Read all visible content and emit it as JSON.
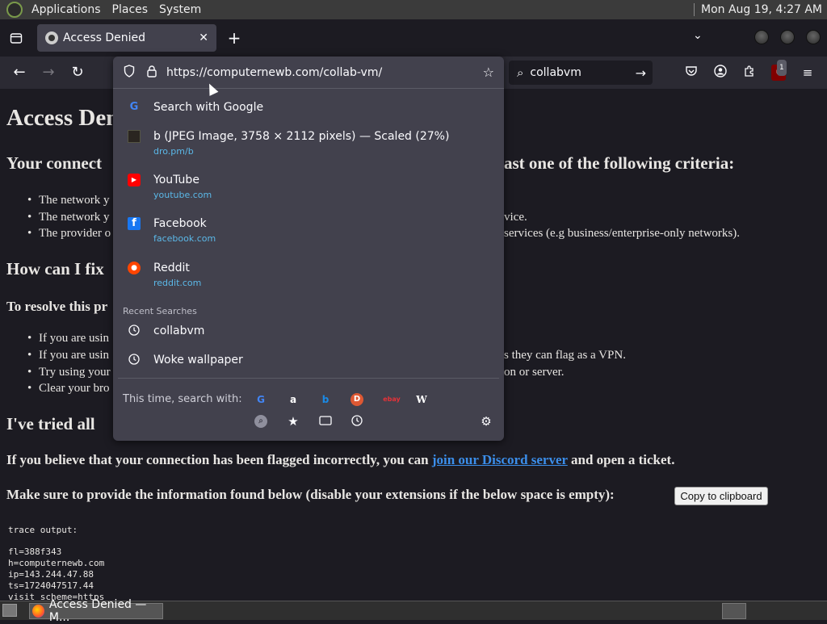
{
  "gnome_panel": {
    "menus": [
      "Applications",
      "Places",
      "System"
    ],
    "clock": "Mon Aug 19,  4:27 AM"
  },
  "tab": {
    "title": "Access Denied",
    "close": "✕"
  },
  "new_tab": "+",
  "tab_list": "⌄",
  "urlbar": {
    "url": "https://computernewb.com/collab-vm/"
  },
  "search": {
    "value": "collabvm"
  },
  "ublock_badge": "1",
  "page": {
    "h1": "Access Denied",
    "h2_connection": "Your connection ... ast one of the following criteria:",
    "bullets1": [
      "The network y",
      "The network y",
      "The provider o"
    ],
    "bullets1_tail": [
      "",
      "vice.",
      "services (e.g business/enterprise-only networks)."
    ],
    "h2_fix": "How can I fix",
    "h3_resolve": "To resolve this pr",
    "bullets2": [
      "If you are usin",
      "If you are usin",
      "Try using your",
      "Clear your bro"
    ],
    "bullets2_tail": [
      "",
      "s they can flag as a VPN.",
      "on or server.",
      ""
    ],
    "h2_tried": "I've tried all",
    "flagged_before": "If you believe that your connection has been flagged incorrectly, you can",
    "flagged_link": "join our Discord server",
    "flagged_after": "and open a ticket.",
    "provide_info": "Make sure to provide the information found below (disable your extensions if the below space is empty):",
    "copy_button": "Copy to clipboard",
    "trace_label": "trace output:",
    "trace_lines": [
      "fl=388f343",
      "h=computernewb.com",
      "ip=143.244.47.88",
      "ts=1724047517.44",
      "visit_scheme=https"
    ]
  },
  "popup": {
    "rows": [
      {
        "title": "Search with Google",
        "sub": "",
        "icon": "google-icon"
      },
      {
        "title": "b (JPEG Image, 3758 × 2112 pixels) — Scaled (27%)",
        "sub": "dro.pm/b",
        "icon": "image-thumbnail-icon"
      },
      {
        "title": "YouTube",
        "sub": "youtube.com",
        "icon": "youtube-icon"
      },
      {
        "title": "Facebook",
        "sub": "facebook.com",
        "icon": "facebook-icon"
      },
      {
        "title": "Reddit",
        "sub": "reddit.com",
        "icon": "reddit-icon"
      }
    ],
    "recent_label": "Recent Searches",
    "recent": [
      "collabvm",
      "Woke wallpaper"
    ],
    "this_time": "This time, search with:",
    "engines": [
      "google-icon",
      "amazon-icon",
      "bing-icon",
      "duckduckgo-icon",
      "ebay-icon",
      "wikipedia-icon"
    ],
    "engine_glyphs": [
      "G",
      "a",
      "b",
      "D",
      "ebay",
      "W"
    ]
  },
  "taskbar": {
    "task_title": "Access Denied — M..."
  }
}
